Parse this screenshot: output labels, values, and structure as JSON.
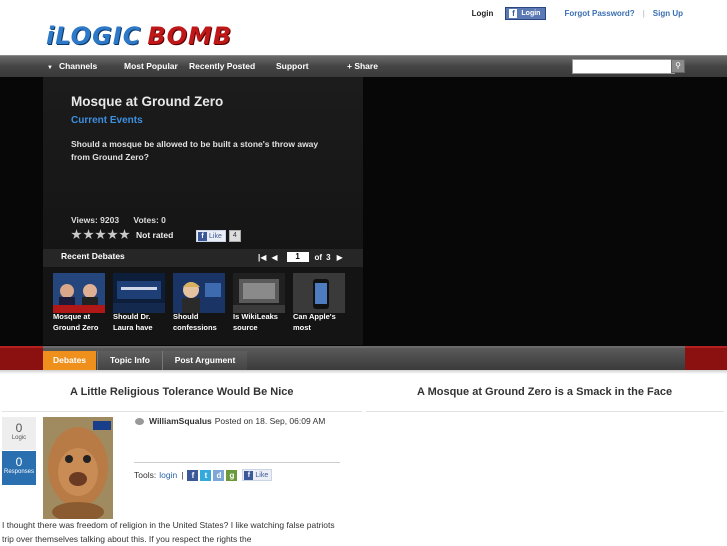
{
  "header": {
    "logo_part1": "iLOGIC",
    "logo_part2": "BOMB",
    "login": "Login",
    "fb_login": "Login",
    "forgot": "Forgot Password?",
    "signup": "Sign Up"
  },
  "nav": {
    "channels": "Channels",
    "popular": "Most Popular",
    "recent": "Recently Posted",
    "support": "Support",
    "share": "+ Share",
    "search_value": ""
  },
  "debate": {
    "title": "Mosque at Ground Zero",
    "category": "Current Events",
    "question": "Should a mosque be allowed to be built a stone's throw away from Ground Zero?",
    "views": "Views: 9203",
    "votes": "Votes: 0",
    "rating": "Not rated",
    "like": "Like",
    "like_count": "4"
  },
  "recent": {
    "title": "Recent Debates",
    "page": "1",
    "of": "of",
    "total": "3",
    "items": [
      {
        "caption": "Mosque at Ground Zero"
      },
      {
        "caption": "Should Dr. Laura have"
      },
      {
        "caption": "Should confessions"
      },
      {
        "caption": "Is WikiLeaks source"
      },
      {
        "caption": "Can Apple's most"
      }
    ]
  },
  "tabs": {
    "debates": "Debates",
    "topic": "Topic Info",
    "post": "Post Argument"
  },
  "columns": {
    "left": "A Little Religious Tolerance Would Be Nice",
    "right": "A Mosque at Ground Zero is a Smack in the Face"
  },
  "post": {
    "logic_score": "0",
    "logic_label": "Logic",
    "responses": "0",
    "responses_label": "Responses",
    "author": "WilliamSqualus",
    "posted": "Posted on 18. Sep, 06:09 AM",
    "tools_label": "Tools:",
    "login_link": "login",
    "like": "Like",
    "body": "I thought there was freedom of religion in the United States? I like watching false patriots trip over themselves talking about this. If you respect the rights the"
  },
  "colors": {
    "accent_orange": "#f0901c",
    "brand_blue": "#2d79c7",
    "brand_red": "#c01818",
    "link_blue": "#3a6fb0"
  }
}
